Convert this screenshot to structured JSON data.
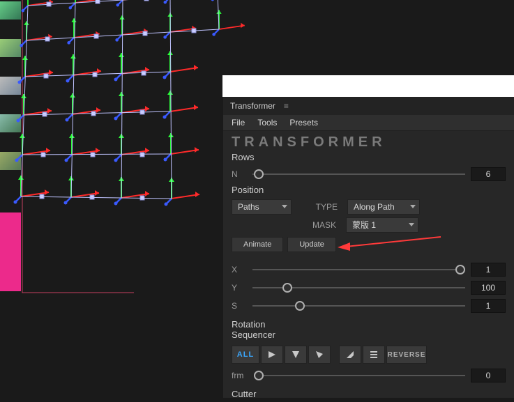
{
  "panel": {
    "title": "Transformer",
    "menu": {
      "file": "File",
      "tools": "Tools",
      "presets": "Presets"
    },
    "logo": "TRANSFORMER"
  },
  "rows": {
    "heading": "Rows",
    "n_label": "N",
    "n_value": "6"
  },
  "position": {
    "heading": "Position",
    "paths_label": "Paths",
    "type_label": "TYPE",
    "type_value": "Along Path",
    "mask_label": "MASK",
    "mask_value": "蒙版 1",
    "animate_btn": "Animate",
    "update_btn": "Update",
    "x_label": "X",
    "x_value": "1",
    "y_label": "Y",
    "y_value": "100",
    "s_label": "S",
    "s_value": "1"
  },
  "sequencer": {
    "rotation_heading": "Rotation",
    "sequencer_heading": "Sequencer",
    "all": "ALL",
    "reverse": "REVERSE",
    "frm_label": "frm",
    "frm_value": "0"
  },
  "cutter": {
    "heading": "Cutter"
  }
}
